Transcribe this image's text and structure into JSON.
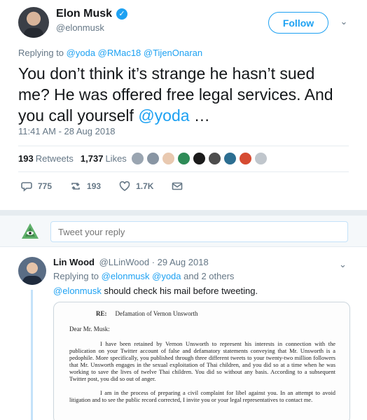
{
  "tweet": {
    "author_name": "Elon Musk",
    "author_handle": "@elonmusk",
    "follow_label": "Follow",
    "replying_prefix": "Replying to",
    "replying_to": "@yoda @RMac18 @TijenOnaran",
    "text_main": "You don’t think it’s strange he hasn’t sued me? He was offered free legal services. And you call yourself ",
    "text_mention": "@yoda",
    "text_end": " …",
    "timestamp": "11:41 AM - 28 Aug 2018",
    "retweets_count": "193",
    "retweets_label": "Retweets",
    "likes_count": "1,737",
    "likes_label": "Likes",
    "action_replies": "775",
    "action_retweets": "193",
    "action_likes": "1.7K"
  },
  "compose": {
    "placeholder": "Tweet your reply"
  },
  "reply": {
    "author_name": "Lin Wood",
    "author_handle": "@LLinWood",
    "date": "· 29 Aug 2018",
    "replying_prefix": "Replying to",
    "replying_links": "@elonmusk @yoda",
    "replying_suffix": "and 2 others",
    "text_mention": "@elonmusk",
    "text_rest": " should check his mail before tweeting."
  },
  "letter": {
    "re_label": "RE:",
    "re_subject": "Defamation of Vernon Unsworth",
    "salutation": "Dear Mr. Musk:",
    "paragraph1": "I have been retained by Vernon Unsworth to represent his interests in connection with the publication on your Twitter account of false and defamatory statements conveying that Mr. Unsworth is a pedophile. More specifically, you published through three different tweets to your twenty-two million followers that Mr. Unsworth engages in the sexual exploitation of Thai children, and you did so at a time when he was working to save the lives of twelve Thai children. You did so without any basis. According to a subsequent Twitter post, you did so out of anger.",
    "paragraph2": "I am in the process of preparing a civil complaint for libel against you. In an attempt to avoid litigation and to see the public record corrected, I invite you or your legal representatives to contact me."
  },
  "colors": {
    "accent": "#1da1f2",
    "text": "#14171a",
    "muted": "#657786"
  }
}
